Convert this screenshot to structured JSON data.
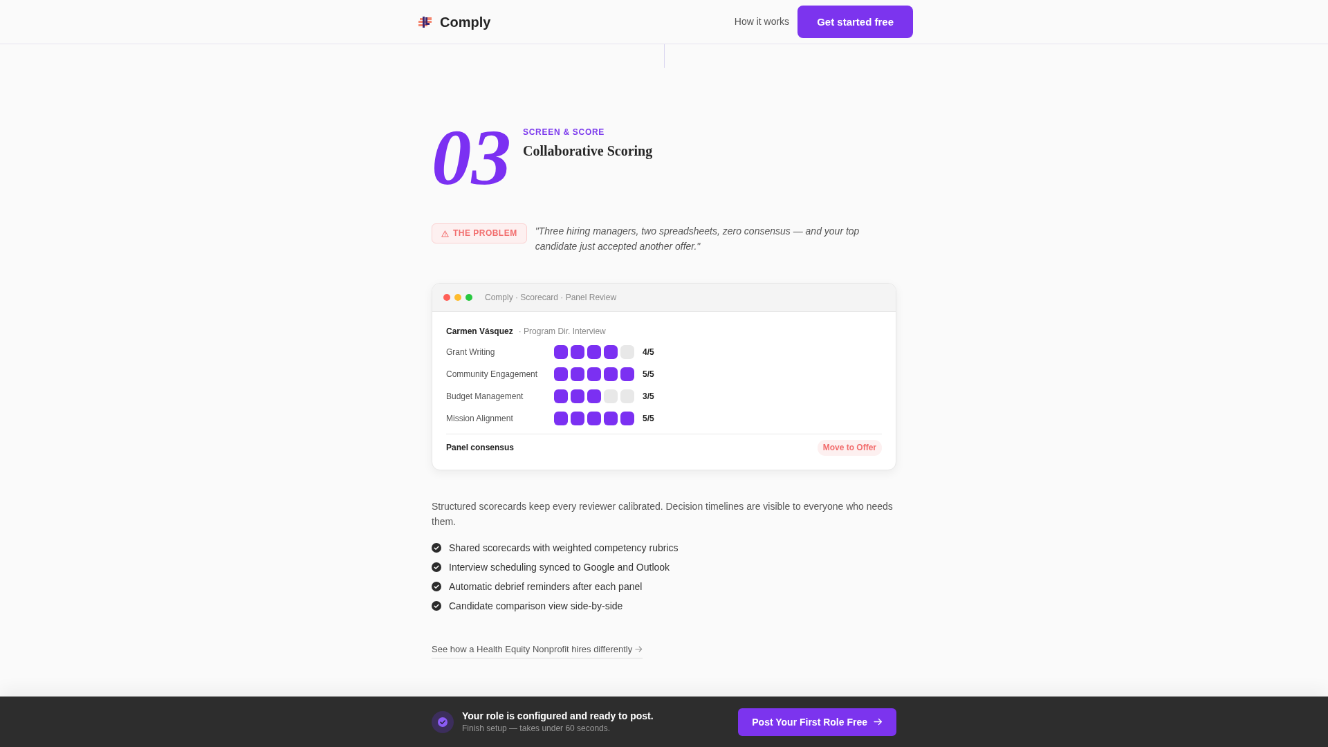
{
  "header": {
    "brand": "Comply",
    "nav_link": "How it works",
    "cta_button": "Get started free"
  },
  "step": {
    "number": "03",
    "kicker": "SCREEN & SCORE",
    "title": "Collaborative Scoring",
    "problem": {
      "badge": "THE PROBLEM",
      "quote": "\"Three hiring managers, two spreadsheets, zero consensus — and your top candidate just accepted another offer.\""
    },
    "mockup": {
      "title": "Comply · Scorecard · Panel Review",
      "candidate": "Carmen Vásquez",
      "stage": "· Program Dir. Interview",
      "criteria": [
        {
          "label": "Grant Writing",
          "stars": 4,
          "score": "4/5"
        },
        {
          "label": "Community Engagement",
          "stars": 5,
          "score": "5/5"
        },
        {
          "label": "Budget Management",
          "stars": 3,
          "score": "3/5"
        },
        {
          "label": "Mission Alignment",
          "stars": 5,
          "score": "5/5"
        }
      ],
      "consensus_label": "Panel consensus",
      "consensus_badge": "Move to Offer"
    },
    "description": "Structured scorecards keep every reviewer calibrated. Decision timelines are visible to everyone who needs them.",
    "features": [
      "Shared scorecards with weighted competency rubrics",
      "Interview scheduling synced to Google and Outlook",
      "Automatic debrief reminders after each panel",
      "Candidate comparison view side-by-side"
    ],
    "case_link": "See how a Health Equity Nonprofit hires differently"
  },
  "setup_bar": {
    "title": "Your role is configured and ready to post.",
    "subtitle": "Finish setup — takes under 60 seconds.",
    "button": "Post Your First Role Free"
  }
}
